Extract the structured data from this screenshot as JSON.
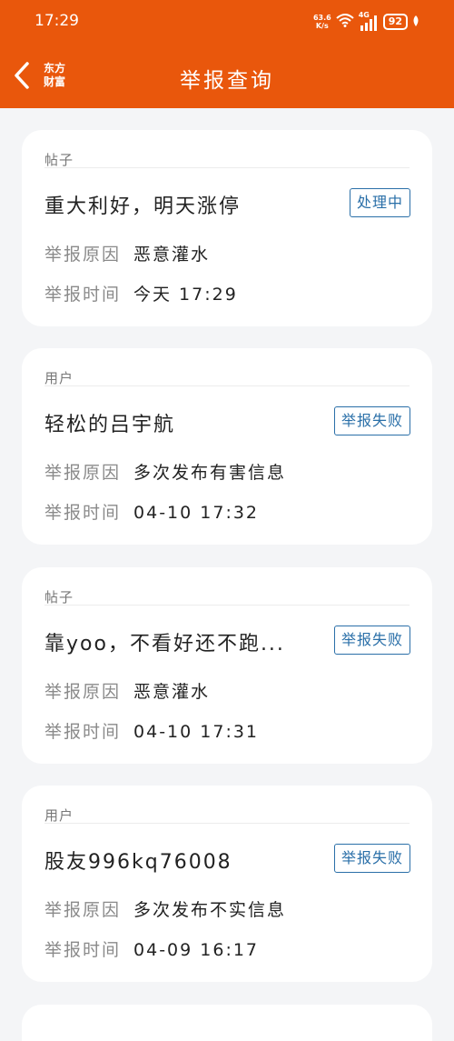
{
  "status_bar": {
    "time": "17:29",
    "net_speed_value": "63.6",
    "net_speed_unit": "K/s",
    "network": "4G",
    "battery": "92"
  },
  "nav": {
    "brand_line1": "东方",
    "brand_line2": "财富",
    "title": "举报查询"
  },
  "labels": {
    "reason": "举报原因",
    "time": "举报时间"
  },
  "reports": [
    {
      "type": "帖子",
      "title": "重大利好，明天涨停",
      "status": "处理中",
      "reason": "恶意灌水",
      "time": "今天 17:29"
    },
    {
      "type": "用户",
      "title": "轻松的吕宇航",
      "status": "举报失败",
      "reason": "多次发布有害信息",
      "time": "04-10 17:32"
    },
    {
      "type": "帖子",
      "title": "靠yoo，不看好还不跑...",
      "status": "举报失败",
      "reason": "恶意灌水",
      "time": "04-10 17:31"
    },
    {
      "type": "用户",
      "title": "股友996kq76008",
      "status": "举报失败",
      "reason": "多次发布不实信息",
      "time": "04-09 16:17"
    }
  ],
  "colors": {
    "header": "#e9570c",
    "badge": "#2a6fa8",
    "background": "#f4f5f7"
  }
}
